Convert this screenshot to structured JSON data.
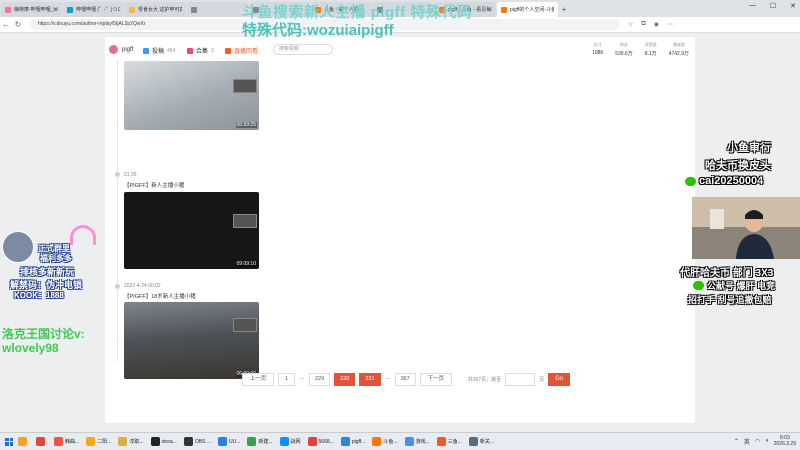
{
  "browser": {
    "tabs": [
      {
        "title": "嗨特摩-哔哩哔哩_bilibili",
        "color": "#fb7299",
        "active": false
      },
      {
        "title": "哔哩哔哩 (゜-゜)つロ 干杯",
        "color": "#00a1d6",
        "active": false
      },
      {
        "title": "零食女大 这护甲可真抗",
        "color": "#f6b93b",
        "active": false
      },
      {
        "title": "",
        "color": "#7f8c8d",
        "active": false
      },
      {
        "title": "",
        "color": "#7f8c8d",
        "active": false
      },
      {
        "title": "斗鱼 - 每个人的",
        "color": "#ff7700",
        "active": false
      },
      {
        "title": "",
        "color": "#7f8c8d",
        "active": false
      },
      {
        "title": "pigff - 斗鱼 - 看见每种",
        "color": "#ff7700",
        "active": false
      },
      {
        "title": "pigff的个人空间-斗鱼视",
        "color": "#ff7700",
        "active": true
      }
    ],
    "new_tab": "+",
    "window_controls": [
      "—",
      "☐",
      "✕"
    ],
    "url": "https://v.douyu.com/author-replay/5IjAL2p2QwXr"
  },
  "site": {
    "username": "pigff",
    "nav": [
      {
        "label": "投稿",
        "count": "454",
        "color": "#3b9cf2",
        "live": false
      },
      {
        "label": "合集",
        "count": "3",
        "color": "#e74c6c",
        "live": false
      },
      {
        "label": "直播回看",
        "count": "",
        "color": "#ff5d23",
        "live": true
      }
    ],
    "search_placeholder": "搜索视频",
    "stats": [
      {
        "label": "关注",
        "value": "1986"
      },
      {
        "label": "粉丝",
        "value": "539.6万"
      },
      {
        "label": "获赞量",
        "value": "8.1万"
      },
      {
        "label": "播放量",
        "value": "4742.9万"
      }
    ]
  },
  "videos": [
    {
      "time": "",
      "title": "",
      "duration": "06:59:25",
      "bg": "#b8c0c4"
    },
    {
      "time": "01:26",
      "title": "【PIGFF】新人主播小猪",
      "duration": "09:09:10",
      "bg": "#151617"
    },
    {
      "time": "2022-4-24 00:02",
      "title": "【PIGFF】18岁新人主播小猪",
      "duration": "06:00:00",
      "bg": "#4e5257"
    }
  ],
  "pagination": {
    "prev": "上一页",
    "pages": [
      "1",
      "...",
      "229",
      "230",
      "231",
      "...",
      "367"
    ],
    "selected": [
      "230",
      "231"
    ],
    "next": "下一页",
    "total_text": "共367页，跳至",
    "unit": "页",
    "go": "Go"
  },
  "overlays": {
    "top_line1": "斗鱼搜索新人主播  pigff 特殊代码",
    "top_line2": "特殊代码:wozuiaipigff",
    "left_line1": "正式群里",
    "left_line2": "福利多多",
    "left_line3": "排核多新新玩",
    "left_line4": "解禁码：伪冲电锁",
    "left_line5": "KOOK：1888",
    "green_line1": "洛克王国讨论v:",
    "green_line2": "wlovely98",
    "right_line1": "小鱼审行",
    "right_line2": "哈夫币换皮头",
    "right_line3": "cai20250004",
    "right_line4": "代肝哈夫币 部门 3X3",
    "right_line5": "公献号 爆肝 电竞",
    "right_line6": "招打手 刮号追撤包赔"
  },
  "taskbar": {
    "items": [
      {
        "label": "",
        "color": "#f0a030"
      },
      {
        "label": "",
        "color": "#d94b3a"
      },
      {
        "label": "韩曲...",
        "color": "#e6574a"
      },
      {
        "label": "二阳...",
        "color": "#f5a623"
      },
      {
        "label": "淳职...",
        "color": "#d8b04a"
      },
      {
        "label": "strea...",
        "color": "#222222"
      },
      {
        "label": "OBS ...",
        "color": "#333333"
      },
      {
        "label": "UU...",
        "color": "#2d7fe0"
      },
      {
        "label": "新建...",
        "color": "#3aa14a"
      },
      {
        "label": "战网",
        "color": "#148eff"
      },
      {
        "label": "5668...",
        "color": "#e0433b"
      },
      {
        "label": "pigff...",
        "color": "#2f86d1"
      },
      {
        "label": "斗鱼...",
        "color": "#ff7700"
      },
      {
        "label": "游戏...",
        "color": "#4a90e2"
      },
      {
        "label": "三鱼...",
        "color": "#e85d2a"
      },
      {
        "label": "新关...",
        "color": "#5b6b7b"
      }
    ],
    "ime": "英",
    "time": "8:03",
    "date": "2026.3.29"
  }
}
